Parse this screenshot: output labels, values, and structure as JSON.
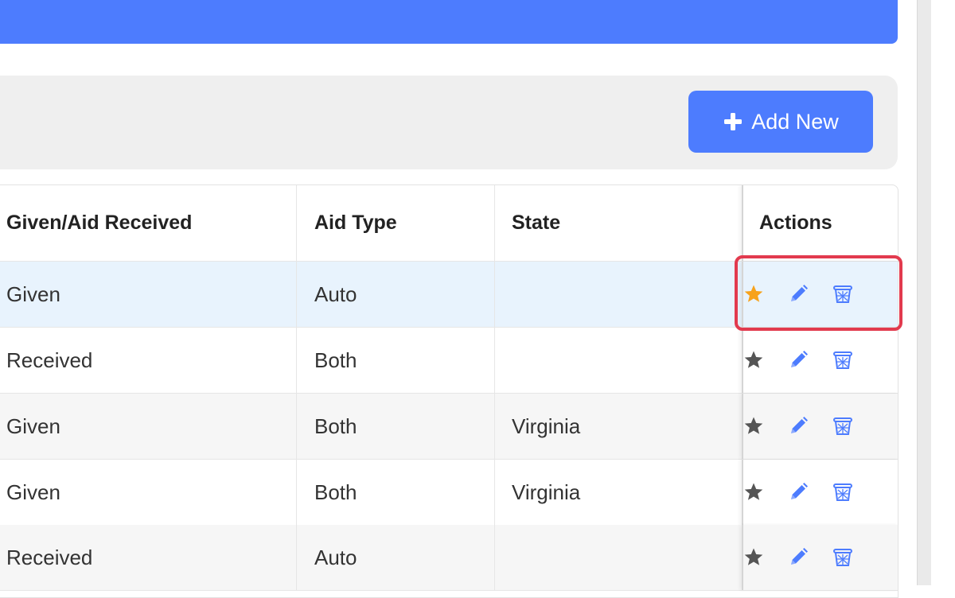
{
  "toolbar": {
    "add_new_label": "Add New"
  },
  "table": {
    "columns": [
      "Given/Aid Received",
      "Aid Type",
      "State",
      "Actions"
    ],
    "rows": [
      {
        "given_received": "Given",
        "aid_type": "Auto",
        "state": "",
        "starred": true
      },
      {
        "given_received": "Received",
        "aid_type": "Both",
        "state": "",
        "starred": false
      },
      {
        "given_received": "Given",
        "aid_type": "Both",
        "state": "Virginia",
        "starred": false
      },
      {
        "given_received": "Given",
        "aid_type": "Both",
        "state": "Virginia",
        "starred": false
      },
      {
        "given_received": "Received",
        "aid_type": "Auto",
        "state": "",
        "starred": false
      }
    ]
  },
  "icons": {
    "plus": "plus-icon",
    "star": "star-icon",
    "edit": "pencil-icon",
    "delete": "trash-icon"
  },
  "colors": {
    "accent": "#4d7cfe",
    "star_active": "#f7a21b",
    "star_inactive": "#555555",
    "highlight": "#e23a4e",
    "selected_row": "#e8f3fd"
  }
}
